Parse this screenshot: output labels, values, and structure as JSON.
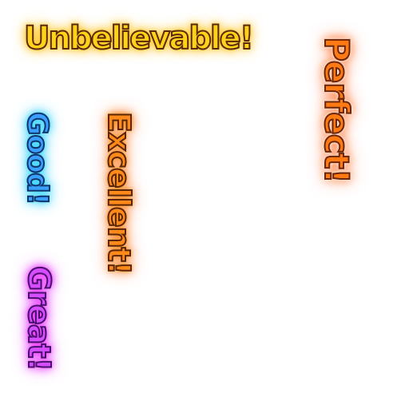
{
  "popups": {
    "unbelievable": "Unbelievable!",
    "perfect": "Perfect!",
    "good": "Good!",
    "excellent": "Excellent!",
    "great": "Great!"
  },
  "colors": {
    "unbelievable": "#ffd21a",
    "perfect": "#ff7a12",
    "good": "#3aa0ff",
    "excellent": "#ff8a1a",
    "great": "#d64cff"
  }
}
